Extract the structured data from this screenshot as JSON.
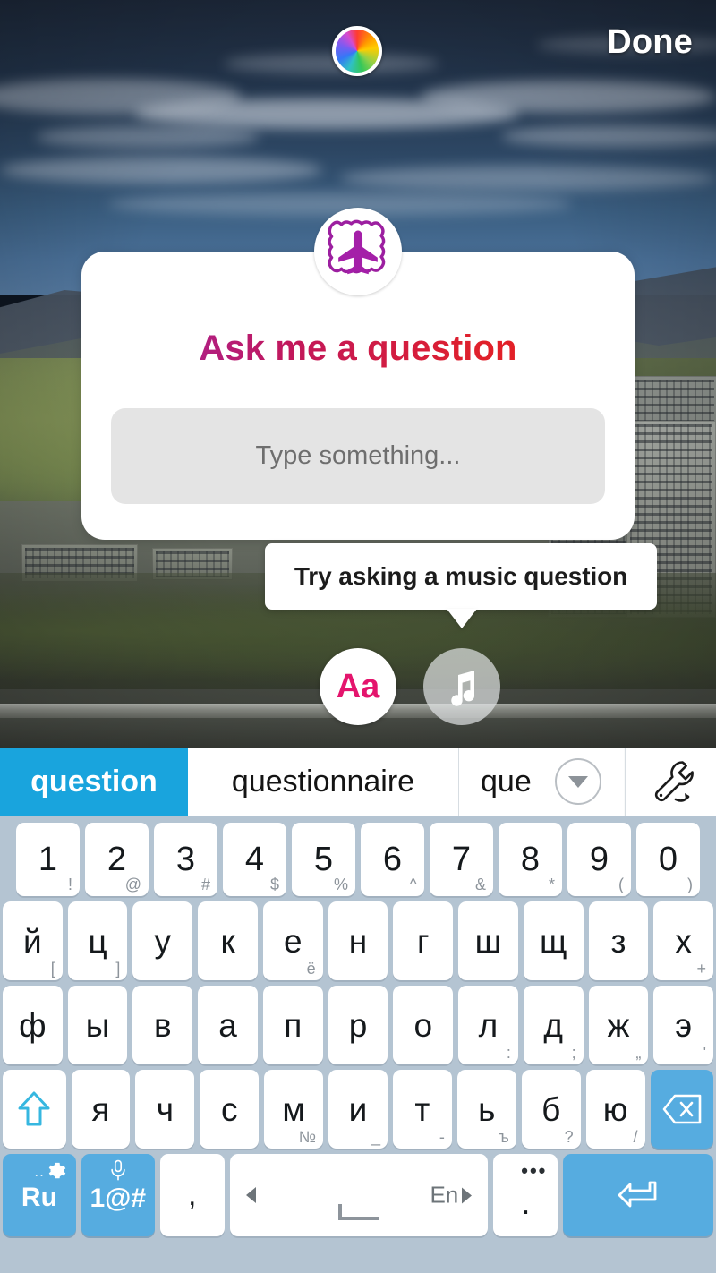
{
  "topbar": {
    "color_wheel_icon": "color-wheel-icon",
    "done_label": "Done"
  },
  "sticker": {
    "avatar_icon": "airplane-avatar-icon",
    "title": "Ask me a question",
    "input_placeholder": "Type something...",
    "title_gradient_start": "#9c27b0",
    "title_gradient_end": "#e8221a",
    "card_background": "#ffffff",
    "input_background": "#e4e4e4"
  },
  "tooltip": {
    "text": "Try asking a music question"
  },
  "modes": [
    {
      "name": "text-mode",
      "label": "Aa",
      "icon": "text-aa-icon",
      "color": "#e4156d",
      "selected": true
    },
    {
      "name": "music-mode",
      "label": "",
      "icon": "music-note-icon",
      "color": "#ffffff",
      "selected": false
    }
  ],
  "keyboard": {
    "accent_color": "#19a4dd",
    "key_blue": "#56ace0",
    "background": "#b4c4d2",
    "suggestions": [
      {
        "text": "question",
        "active": true
      },
      {
        "text": "questionnaire",
        "active": false
      },
      {
        "text": "que",
        "active": false
      }
    ],
    "expand_icon": "chevron-down-icon",
    "tools_icon": "wrench-tools-icon",
    "rows": {
      "numbers": [
        {
          "main": "1",
          "alt": "!"
        },
        {
          "main": "2",
          "alt": "@"
        },
        {
          "main": "3",
          "alt": "#"
        },
        {
          "main": "4",
          "alt": "$"
        },
        {
          "main": "5",
          "alt": "%"
        },
        {
          "main": "6",
          "alt": "^"
        },
        {
          "main": "7",
          "alt": "&"
        },
        {
          "main": "8",
          "alt": "*"
        },
        {
          "main": "9",
          "alt": "("
        },
        {
          "main": "0",
          "alt": ")"
        }
      ],
      "row1": [
        {
          "main": "й",
          "alt": "["
        },
        {
          "main": "ц",
          "alt": "]"
        },
        {
          "main": "у",
          "alt": ""
        },
        {
          "main": "к",
          "alt": ""
        },
        {
          "main": "е",
          "alt": "ё"
        },
        {
          "main": "н",
          "alt": ""
        },
        {
          "main": "г",
          "alt": ""
        },
        {
          "main": "ш",
          "alt": ""
        },
        {
          "main": "щ",
          "alt": ""
        },
        {
          "main": "з",
          "alt": ""
        },
        {
          "main": "х",
          "alt": "+"
        }
      ],
      "row2": [
        {
          "main": "ф",
          "alt": ""
        },
        {
          "main": "ы",
          "alt": ""
        },
        {
          "main": "в",
          "alt": ""
        },
        {
          "main": "а",
          "alt": ""
        },
        {
          "main": "п",
          "alt": ""
        },
        {
          "main": "р",
          "alt": ""
        },
        {
          "main": "о",
          "alt": ""
        },
        {
          "main": "л",
          "alt": ":"
        },
        {
          "main": "д",
          "alt": ";"
        },
        {
          "main": "ж",
          "alt": "„"
        },
        {
          "main": "э",
          "alt": "'"
        }
      ],
      "row3": [
        {
          "main": "я",
          "alt": ""
        },
        {
          "main": "ч",
          "alt": ""
        },
        {
          "main": "с",
          "alt": ""
        },
        {
          "main": "м",
          "alt": "№"
        },
        {
          "main": "и",
          "alt": "_"
        },
        {
          "main": "т",
          "alt": "-"
        },
        {
          "main": "ь",
          "alt": "ъ"
        },
        {
          "main": "б",
          "alt": "?"
        },
        {
          "main": "ю",
          "alt": "/"
        }
      ],
      "shift_icon": "shift-arrow-icon",
      "backspace_icon": "backspace-icon",
      "bottom": {
        "lang_label": "Ru",
        "lang_gear_icon": "gear-icon",
        "lang_dots": "..",
        "sym_label": "1@#",
        "sym_mic_icon": "microphone-icon",
        "comma_label": ",",
        "space_en_label": "En",
        "space_prev_icon": "arrow-left-icon",
        "space_next_icon": "arrow-right-icon",
        "period_label": ".",
        "period_dots": "•••",
        "enter_icon": "enter-return-icon"
      }
    }
  }
}
